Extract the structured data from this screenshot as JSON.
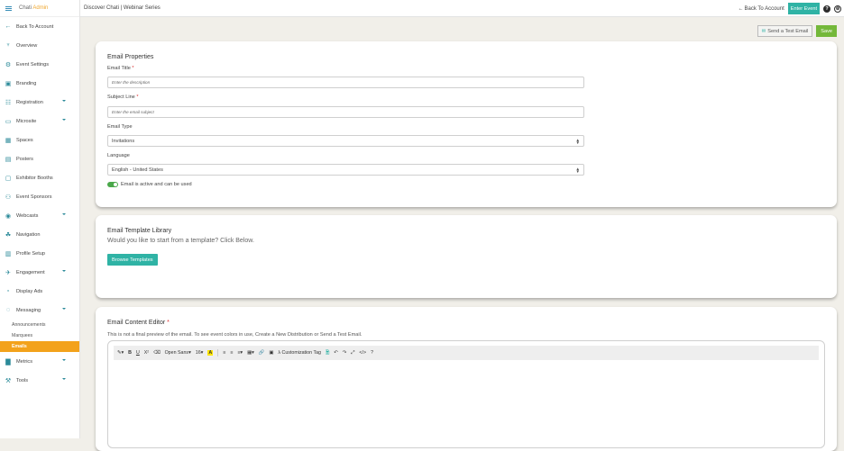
{
  "brand": {
    "name": "Chati",
    "accent": "Admin"
  },
  "sidebar": {
    "items": [
      {
        "label": "Back To Account",
        "icon": "arrow-left-icon"
      },
      {
        "label": "Overview",
        "icon": "sitemap-icon"
      },
      {
        "label": "Event Settings",
        "icon": "gears-icon"
      },
      {
        "label": "Branding",
        "icon": "image-icon"
      },
      {
        "label": "Registration",
        "icon": "form-icon"
      },
      {
        "label": "Microsite",
        "icon": "window-icon"
      },
      {
        "label": "Spaces",
        "icon": "grid-icon"
      },
      {
        "label": "Posters",
        "icon": "poster-icon"
      },
      {
        "label": "Exhibitor Booths",
        "icon": "file-icon"
      },
      {
        "label": "Event Sponsors",
        "icon": "people-icon"
      },
      {
        "label": "Webcasts",
        "icon": "broadcast-icon"
      },
      {
        "label": "Navigation",
        "icon": "nav-tree-icon"
      },
      {
        "label": "Profile Setup",
        "icon": "profile-icon"
      },
      {
        "label": "Engagement",
        "icon": "rocket-icon"
      },
      {
        "label": "Display Ads",
        "icon": "ad-icon"
      },
      {
        "label": "Messaging",
        "icon": "chat-icon"
      }
    ],
    "messaging_sub": [
      "Announcements",
      "Marquees",
      "Emails"
    ],
    "bottom": [
      {
        "label": "Metrics",
        "icon": "bar-chart-icon"
      },
      {
        "label": "Tools",
        "icon": "tools-icon"
      }
    ]
  },
  "topbar": {
    "breadcrumb": "Discover Chati | Webinar Series",
    "back": "Back To Account",
    "enter": "Enter Event",
    "help": "?",
    "user": "⊚"
  },
  "actions": {
    "test": "Send a Test Email",
    "save": "Save"
  },
  "props": {
    "title": "Email Properties",
    "email_title_label": "Email Title",
    "email_title_ph": "Enter the description",
    "subject_label": "Subject Line",
    "subject_ph": "Enter the email subject",
    "type_label": "Email Type",
    "type_value": "Invitations",
    "lang_label": "Language",
    "lang_value": "English - United States",
    "active_text": "Email is active and can be used",
    "required": "*"
  },
  "library": {
    "title": "Email Template Library",
    "subtitle": "Would you like to start from a template? Click Below.",
    "button": "Browse Templates"
  },
  "editor": {
    "title": "Email Content Editor",
    "note": "This is not a final preview of the email. To see event colors in use, Create a New Distribution or Send a Test Email.",
    "font": "Open Sans",
    "size": "16",
    "tag": "Customization Tag"
  },
  "colors": {
    "teal": "#2fb3a5",
    "orange": "#f3a21b",
    "green": "#74b83a"
  }
}
